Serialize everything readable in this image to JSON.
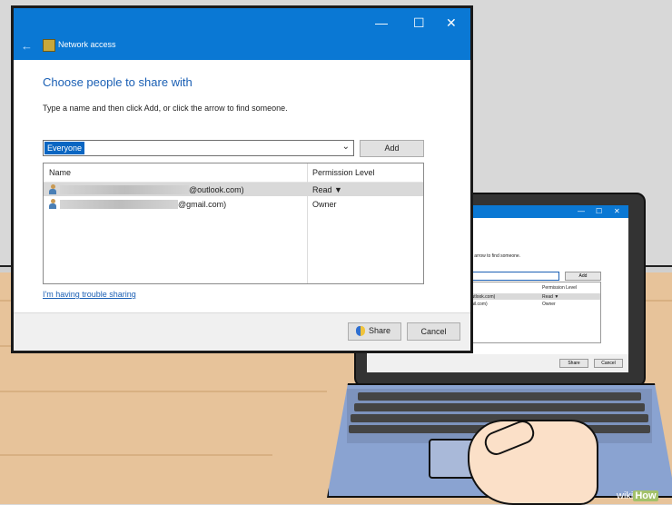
{
  "window": {
    "title": "Network access",
    "controls": {
      "minimize": "—",
      "maximize": "☐",
      "close": "✕"
    },
    "back": "←"
  },
  "dialog": {
    "heading": "Choose people to share with",
    "instruction": "Type a name and then click Add, or click the arrow to find someone.",
    "combo_value": "Everyone",
    "add_label": "Add",
    "columns": {
      "name": "Name",
      "permission": "Permission Level"
    },
    "rows": [
      {
        "email_suffix": "@outlook.com)",
        "permission": "Read ▼",
        "selected": true
      },
      {
        "email_suffix": "@gmail.com)",
        "permission": "Owner",
        "selected": false
      }
    ],
    "trouble_link": "I'm having trouble sharing",
    "share_label": "Share",
    "cancel_label": "Cancel"
  },
  "laptop_screen": {
    "instruction_fragment": "k the arrow to find someone.",
    "add_label": "Add",
    "permission_header": "Permission Level",
    "row1_email": "(outlook.com)",
    "row1_perm": "Read ▼",
    "row2_email": "mail.com)",
    "row2_perm": "Owner",
    "share_label": "Share",
    "cancel_label": "Cancel"
  },
  "watermark": {
    "wiki": "wiki",
    "how": "How"
  },
  "colors": {
    "accent": "#0a78d4",
    "link": "#1a5fb4",
    "selection": "#0a66c2"
  },
  "icons": [
    "back-arrow-icon",
    "network-folder-icon",
    "user-icon",
    "shield-icon",
    "chevron-down-icon"
  ]
}
